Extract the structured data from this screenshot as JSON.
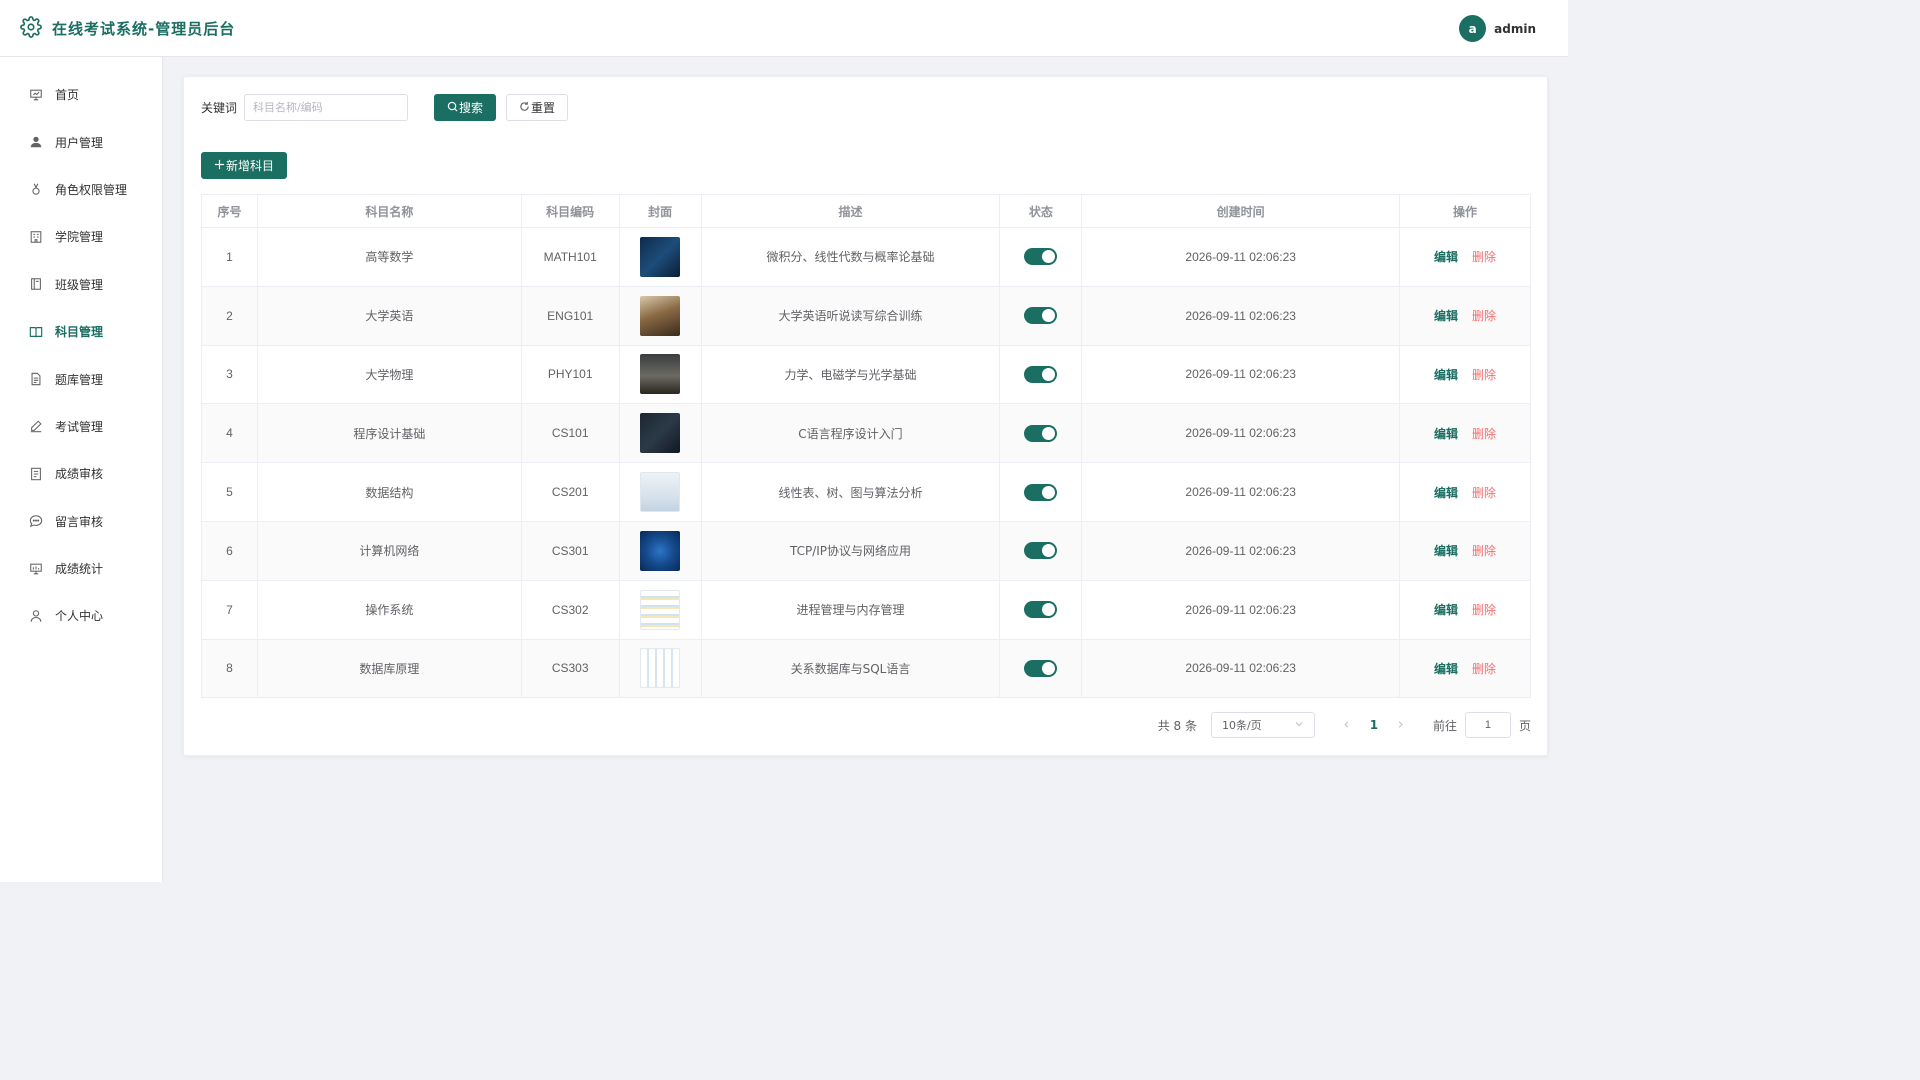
{
  "header": {
    "title": "在线考试系统-管理员后台",
    "avatar_letter": "a",
    "username": "admin"
  },
  "sidebar": {
    "items": [
      {
        "label": "首页",
        "icon": "dashboard-icon",
        "active": false
      },
      {
        "label": "用户管理",
        "icon": "user-filled-icon",
        "active": false
      },
      {
        "label": "角色权限管理",
        "icon": "medal-icon",
        "active": false
      },
      {
        "label": "学院管理",
        "icon": "building-icon",
        "active": false
      },
      {
        "label": "班级管理",
        "icon": "notebook-icon",
        "active": false
      },
      {
        "label": "科目管理",
        "icon": "book-icon",
        "active": true
      },
      {
        "label": "题库管理",
        "icon": "document-icon",
        "active": false
      },
      {
        "label": "考试管理",
        "icon": "edit-pen-icon",
        "active": false
      },
      {
        "label": "成绩审核",
        "icon": "tickets-icon",
        "active": false
      },
      {
        "label": "留言审核",
        "icon": "chat-icon",
        "active": false
      },
      {
        "label": "成绩统计",
        "icon": "data-board-icon",
        "active": false
      },
      {
        "label": "个人中心",
        "icon": "user-outline-icon",
        "active": false
      }
    ]
  },
  "search": {
    "label": "关键词",
    "placeholder": "科目名称/编码",
    "value": "",
    "search_button": "搜索",
    "reset_button": "重置"
  },
  "toolbar": {
    "add_button": "新增科目"
  },
  "table": {
    "columns": [
      "序号",
      "科目名称",
      "科目编码",
      "封面",
      "描述",
      "状态",
      "创建时间",
      "操作"
    ],
    "edit_label": "编辑",
    "delete_label": "删除",
    "rows": [
      {
        "no": "1",
        "name": "高等数学",
        "code": "MATH101",
        "cover": "math-cover",
        "desc": "微积分、线性代数与概率论基础",
        "enabled": true,
        "created": "2026-09-11 02:06:23"
      },
      {
        "no": "2",
        "name": "大学英语",
        "code": "ENG101",
        "cover": "english-cover",
        "desc": "大学英语听说读写综合训练",
        "enabled": true,
        "created": "2026-09-11 02:06:23"
      },
      {
        "no": "3",
        "name": "大学物理",
        "code": "PHY101",
        "cover": "physics-cover",
        "desc": "力学、电磁学与光学基础",
        "enabled": true,
        "created": "2026-09-11 02:06:23"
      },
      {
        "no": "4",
        "name": "程序设计基础",
        "code": "CS101",
        "cover": "programming-cover",
        "desc": "C语言程序设计入门",
        "enabled": true,
        "created": "2026-09-11 02:06:23"
      },
      {
        "no": "5",
        "name": "数据结构",
        "code": "CS201",
        "cover": "data-structure-cover",
        "desc": "线性表、树、图与算法分析",
        "enabled": true,
        "created": "2026-09-11 02:06:23"
      },
      {
        "no": "6",
        "name": "计算机网络",
        "code": "CS301",
        "cover": "network-cover",
        "desc": "TCP/IP协议与网络应用",
        "enabled": true,
        "created": "2026-09-11 02:06:23"
      },
      {
        "no": "7",
        "name": "操作系统",
        "code": "CS302",
        "cover": "os-cover",
        "desc": "进程管理与内存管理",
        "enabled": true,
        "created": "2026-09-11 02:06:23"
      },
      {
        "no": "8",
        "name": "数据库原理",
        "code": "CS303",
        "cover": "database-cover",
        "desc": "关系数据库与SQL语言",
        "enabled": true,
        "created": "2026-09-11 02:06:23"
      }
    ]
  },
  "pagination": {
    "total": "共 8 条",
    "page_size": "10条/页",
    "current_page": "1",
    "goto_label": "前往",
    "goto_value": "1",
    "page_suffix": "页"
  },
  "colors": {
    "primary": "#1a6e62",
    "danger": "#f56c6c"
  }
}
